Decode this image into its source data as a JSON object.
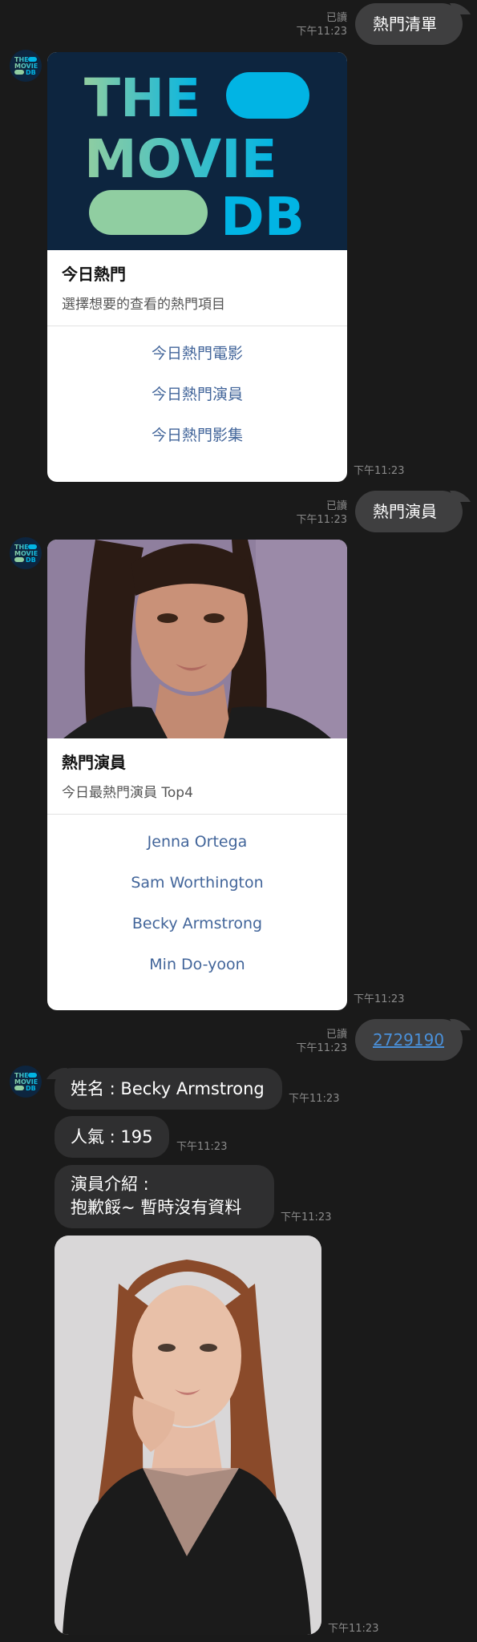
{
  "logo_text": [
    "THE",
    "MOVIE",
    "DB"
  ],
  "messages": {
    "m1": {
      "text": "熱門清單",
      "read": "已讀",
      "time": "下午11:23"
    },
    "card1": {
      "title": "今日熱門",
      "subtitle": "選擇想要的查看的熱門項目",
      "actions": [
        "今日熱門電影",
        "今日熱門演員",
        "今日熱門影集"
      ],
      "time": "下午11:23"
    },
    "m2": {
      "text": "熱門演員",
      "read": "已讀",
      "time": "下午11:23"
    },
    "card2": {
      "title": "熱門演員",
      "subtitle": "今日最熱門演員 Top4",
      "actions": [
        "Jenna Ortega",
        "Sam Worthington",
        "Becky Armstrong",
        "Min Do-yoon"
      ],
      "time": "下午11:23"
    },
    "m3": {
      "text": "2729190",
      "read": "已讀",
      "time": "下午11:23"
    },
    "reply": {
      "name": "姓名 : Becky Armstrong",
      "name_time": "下午11:23",
      "popularity": "人氣 : 195",
      "popularity_time": "下午11:23",
      "bio_line1": "演員介紹 :",
      "bio_line2": "抱歉餒~ 暫時沒有資料",
      "bio_time": "下午11:23",
      "photo_time": "下午11:23"
    }
  },
  "colors": {
    "background": "#1a1a1a",
    "outgoing_bubble": "#3f3f40",
    "incoming_bubble": "#2f2f30",
    "card_action": "#42659a",
    "link": "#4a90d9",
    "tmdb_navy": "#0d253f",
    "tmdb_teal": "#01b4e4",
    "tmdb_green": "#90cea1"
  }
}
